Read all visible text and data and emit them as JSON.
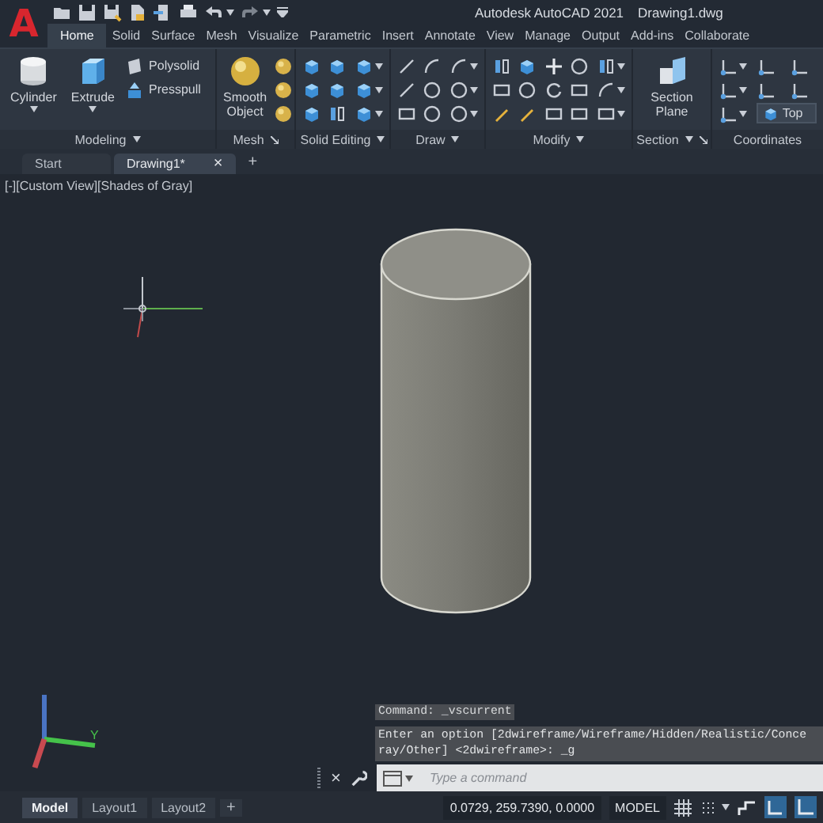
{
  "app": {
    "logo": "A",
    "title": "Autodesk AutoCAD 2021",
    "file_name": "Drawing1.dwg"
  },
  "ribbon_tabs": [
    {
      "label": "Home",
      "selected": true
    },
    {
      "label": "Solid",
      "selected": false
    },
    {
      "label": "Surface",
      "selected": false
    },
    {
      "label": "Mesh",
      "selected": false
    },
    {
      "label": "Visualize",
      "selected": false
    },
    {
      "label": "Parametric",
      "selected": false
    },
    {
      "label": "Insert",
      "selected": false
    },
    {
      "label": "Annotate",
      "selected": false
    },
    {
      "label": "View",
      "selected": false
    },
    {
      "label": "Manage",
      "selected": false
    },
    {
      "label": "Output",
      "selected": false
    },
    {
      "label": "Add-ins",
      "selected": false
    },
    {
      "label": "Collaborate",
      "selected": false
    }
  ],
  "ribbon_panels": [
    {
      "title": "Modeling",
      "dropdown": true,
      "launcher": false,
      "items": [
        {
          "kind": "large",
          "label": "Cylinder",
          "dropdown": true
        },
        {
          "kind": "large",
          "label": "Extrude",
          "dropdown": true
        },
        {
          "kind": "small",
          "label": "Polysolid",
          "dropdown": false
        },
        {
          "kind": "small",
          "label": "Presspull",
          "dropdown": false
        }
      ]
    },
    {
      "title": "Mesh",
      "dropdown": false,
      "launcher": true,
      "items": [
        {
          "kind": "large",
          "label": "Smooth Object",
          "dropdown": false
        },
        {
          "kind": "icon",
          "dropdown": false
        },
        {
          "kind": "icon",
          "dropdown": false
        },
        {
          "kind": "icon",
          "dropdown": false
        }
      ]
    },
    {
      "title": "Solid Editing",
      "dropdown": true,
      "launcher": false,
      "items": [
        {
          "kind": "icon",
          "dropdown": false
        },
        {
          "kind": "icon",
          "dropdown": false
        },
        {
          "kind": "icon",
          "dropdown": false
        },
        {
          "kind": "icon",
          "dropdown": false
        },
        {
          "kind": "icon",
          "dropdown": false
        },
        {
          "kind": "icon",
          "dropdown": false
        },
        {
          "kind": "icon",
          "dropdown": true
        },
        {
          "kind": "icon",
          "dropdown": true
        },
        {
          "kind": "icon",
          "dropdown": true
        }
      ]
    },
    {
      "title": "Draw",
      "dropdown": true,
      "launcher": false,
      "items": [
        {
          "kind": "icon",
          "dropdown": false
        },
        {
          "kind": "icon",
          "dropdown": false
        },
        {
          "kind": "icon",
          "dropdown": false
        },
        {
          "kind": "icon",
          "dropdown": false
        },
        {
          "kind": "icon",
          "dropdown": false
        },
        {
          "kind": "icon",
          "dropdown": false
        },
        {
          "kind": "icon",
          "dropdown": true
        },
        {
          "kind": "icon",
          "dropdown": true
        },
        {
          "kind": "icon",
          "dropdown": true
        }
      ]
    },
    {
      "title": "Modify",
      "dropdown": true,
      "launcher": false,
      "items": [
        {
          "kind": "icon",
          "dropdown": false
        },
        {
          "kind": "icon",
          "dropdown": false
        },
        {
          "kind": "icon",
          "dropdown": false
        },
        {
          "kind": "icon",
          "dropdown": false
        },
        {
          "kind": "icon",
          "dropdown": false
        },
        {
          "kind": "icon",
          "dropdown": false
        },
        {
          "kind": "icon",
          "dropdown": false
        },
        {
          "kind": "icon",
          "dropdown": false
        },
        {
          "kind": "icon",
          "dropdown": false
        },
        {
          "kind": "icon",
          "dropdown": false
        },
        {
          "kind": "icon",
          "dropdown": false
        },
        {
          "kind": "icon",
          "dropdown": false
        },
        {
          "kind": "icon",
          "dropdown": true
        },
        {
          "kind": "icon",
          "dropdown": true
        },
        {
          "kind": "icon",
          "dropdown": true
        }
      ]
    },
    {
      "title": "Section",
      "dropdown": true,
      "launcher": true,
      "items": [
        {
          "kind": "large",
          "label": "Section Plane",
          "dropdown": false
        }
      ]
    },
    {
      "title": "Coordinates",
      "dropdown": false,
      "launcher": false,
      "items": [
        {
          "kind": "icon",
          "dropdown": true
        },
        {
          "kind": "icon",
          "dropdown": true
        },
        {
          "kind": "icon",
          "dropdown": true
        },
        {
          "kind": "icon",
          "dropdown": false
        },
        {
          "kind": "icon",
          "dropdown": false
        },
        {
          "kind": "select",
          "value": "Top"
        },
        {
          "kind": "icon",
          "dropdown": false
        },
        {
          "kind": "icon",
          "dropdown": false
        }
      ]
    }
  ],
  "file_tabs": [
    {
      "label": "Start",
      "selected": false,
      "closable": false
    },
    {
      "label": "Drawing1*",
      "selected": true,
      "closable": true
    }
  ],
  "file_tab_close": "×",
  "file_tab_add": "+",
  "viewport_controls": [
    "[-]",
    "[Custom View]",
    "[Shades of Gray]"
  ],
  "axis_label": "Y",
  "command_history": [
    "Command: _vscurrent"
  ],
  "command_prompt": [
    "Enter an option [2dwireframe/Wireframe/Hidden/Realistic/Conce",
    "ray/Other] <2dwireframe>: _g"
  ],
  "command_close": "×",
  "command_input": {
    "placeholder": "Type a command"
  },
  "layout_tabs": [
    {
      "label": "Model",
      "selected": true
    },
    {
      "label": "Layout1",
      "selected": false
    },
    {
      "label": "Layout2",
      "selected": false
    }
  ],
  "layout_add": "+",
  "status_bar": {
    "coordinates": "0.0729, 259.7390, 0.0000",
    "space": "MODEL"
  }
}
